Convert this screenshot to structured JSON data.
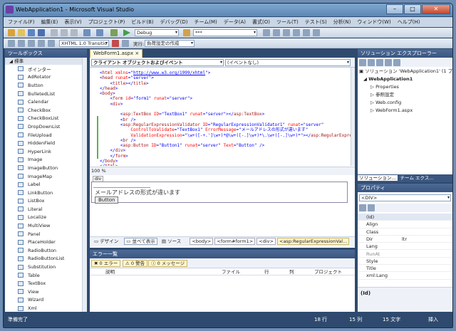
{
  "window": {
    "title": "WebApplication1 - Microsoft Visual Studio",
    "min": "–",
    "max": "□",
    "close": "✕"
  },
  "menu": [
    "ファイル(F)",
    "編集(E)",
    "表示(V)",
    "プロジェクト(P)",
    "ビルド(B)",
    "デバッグ(D)",
    "チーム(M)",
    "データ(A)",
    "書式(O)",
    "ツール(T)",
    "テスト(S)",
    "分析(N)",
    "ウィンドウ(W)",
    "ヘルプ(H)"
  ],
  "toolbar": {
    "config": "Debug",
    "search": "***",
    "doctype": "XHTML 1.0 Transitio",
    "run_label": "実行:",
    "run_target": "負荷設定の作成"
  },
  "toolbox": {
    "title": "ツールボックス",
    "category": "標準",
    "items": [
      "ポインター",
      "AdRotator",
      "Button",
      "BulletedList",
      "Calendar",
      "CheckBox",
      "CheckBoxList",
      "DropDownList",
      "FileUpload",
      "HiddenField",
      "HyperLink",
      "Image",
      "ImageButton",
      "ImageMap",
      "Label",
      "LinkButton",
      "ListBox",
      "Literal",
      "Localize",
      "MultiView",
      "Panel",
      "PlaceHolder",
      "RadioButton",
      "RadioButtonList",
      "Substitution",
      "Table",
      "TextBox",
      "View",
      "Wizard",
      "Xml"
    ]
  },
  "editor": {
    "tab": "WebForm1.aspx",
    "tab_close": "×",
    "left_combo": "クライアント オブジェクトおよびイベント",
    "right_combo": "(イベントなし)",
    "zoom": "100 %"
  },
  "design": {
    "div_tag": "div",
    "error_text": "メールアドレスの形式が違います",
    "button_text": "Button",
    "tabs": {
      "design": "デザイン",
      "split": "並べて表示",
      "source": "ソース"
    },
    "crumbs": [
      "<body>",
      "<form#form1>",
      "<div>",
      "<asp:RegularExpressionVal..."
    ]
  },
  "errors": {
    "title": "エラー一覧",
    "errors": "0 エラー",
    "warnings": "0 警告",
    "messages": "0 メッセージ",
    "cols": [
      "説明",
      "ファイル",
      "行",
      "列",
      "プロジェクト"
    ]
  },
  "solution": {
    "title": "ソリューション エクスプローラー",
    "items": [
      "ソリューション 'WebApplication1' (1 プ",
      "WebApplication1",
      "Properties",
      "参照設定",
      "Web.config",
      "WebForm1.aspx"
    ],
    "tab1": "ソリューション...",
    "tab2": "チーム エクス..."
  },
  "properties": {
    "title": "プロパティ",
    "selected": "<DIV>",
    "rows": [
      [
        "(Id)",
        ""
      ],
      [
        "Align",
        ""
      ],
      [
        "Class",
        ""
      ],
      [
        "Dir",
        "ltr"
      ],
      [
        "Lang",
        ""
      ],
      [
        "RunAt",
        ""
      ],
      [
        "Style",
        ""
      ],
      [
        "Title",
        ""
      ],
      [
        "xml:Lang",
        ""
      ]
    ],
    "desc": "(Id)"
  },
  "status": {
    "ready": "準備完了",
    "line": "18 行",
    "col": "15 列",
    "char": "15 文字",
    "mode": "挿入"
  }
}
